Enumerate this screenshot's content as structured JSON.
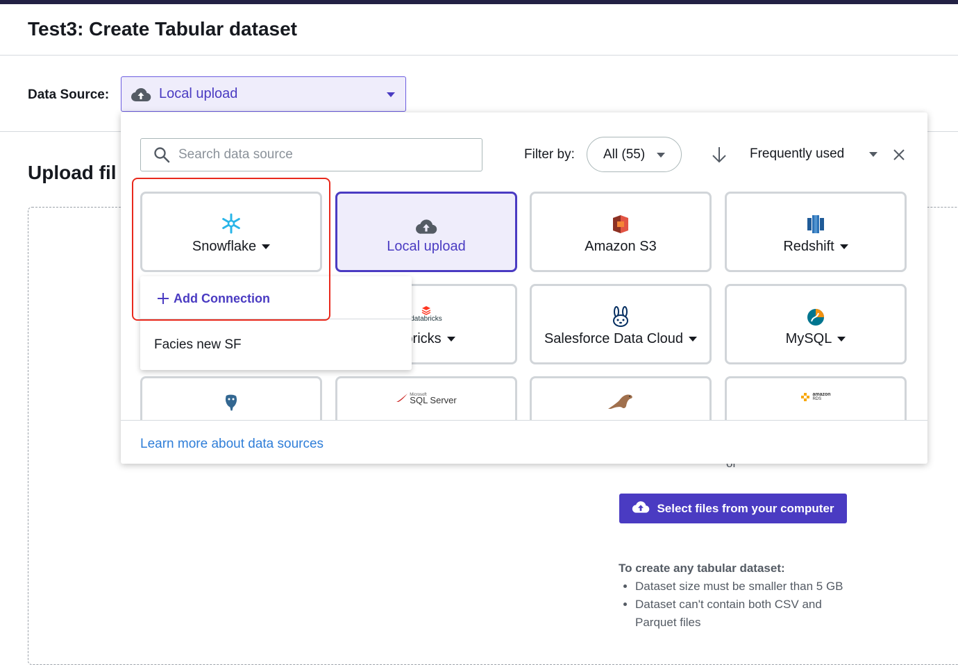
{
  "page": {
    "title": "Test3: Create Tabular dataset"
  },
  "data_source": {
    "label": "Data Source:",
    "selected": "Local upload"
  },
  "upload": {
    "heading": "Upload fil",
    "or_text": "or",
    "select_files_button": "Select files from your computer",
    "requirements_title": "To create any tabular dataset:",
    "requirements": [
      "Dataset size must be smaller than 5 GB",
      "Dataset can't contain both CSV and Parquet files"
    ]
  },
  "dropdown": {
    "search_placeholder": "Search data source",
    "filter_label": "Filter by:",
    "filter_value": "All (55)",
    "sort_value": "Frequently used",
    "tiles": [
      {
        "name": "Snowflake",
        "icon": "snowflake-icon",
        "has_menu": true
      },
      {
        "name": "Local upload",
        "icon": "cloud-upload-icon",
        "has_menu": false,
        "selected": true
      },
      {
        "name": "Amazon S3",
        "icon": "amazon-s3-icon",
        "has_menu": false
      },
      {
        "name": "Redshift",
        "icon": "redshift-icon",
        "has_menu": true
      },
      {
        "name": "abricks",
        "icon": "databricks-icon",
        "logo_text": "databricks",
        "has_menu": true
      },
      {
        "name": "Salesforce Data Cloud",
        "icon": "salesforce-icon",
        "has_menu": true
      },
      {
        "name": "MySQL",
        "icon": "mysql-icon",
        "has_menu": true
      },
      {
        "name": "",
        "icon": "postgresql-icon"
      },
      {
        "name": "",
        "icon": "sql-server-icon",
        "logo_text": "SQL Server",
        "logo_small": "Microsoft"
      },
      {
        "name": "",
        "icon": "mariadb-seal-icon"
      },
      {
        "name": "",
        "icon": "amazon-rds-icon",
        "logo_text": "amazon",
        "logo_small": "RDS"
      }
    ],
    "learn_more": "Learn more about data sources"
  },
  "connection_menu": {
    "add_connection": "Add Connection",
    "items": [
      "Facies new SF"
    ]
  },
  "colors": {
    "accent": "#4a3bc2",
    "selected_bg": "#efedfb",
    "highlight": "#e8291c",
    "link": "#2f7ed8",
    "topbar": "#232144"
  }
}
